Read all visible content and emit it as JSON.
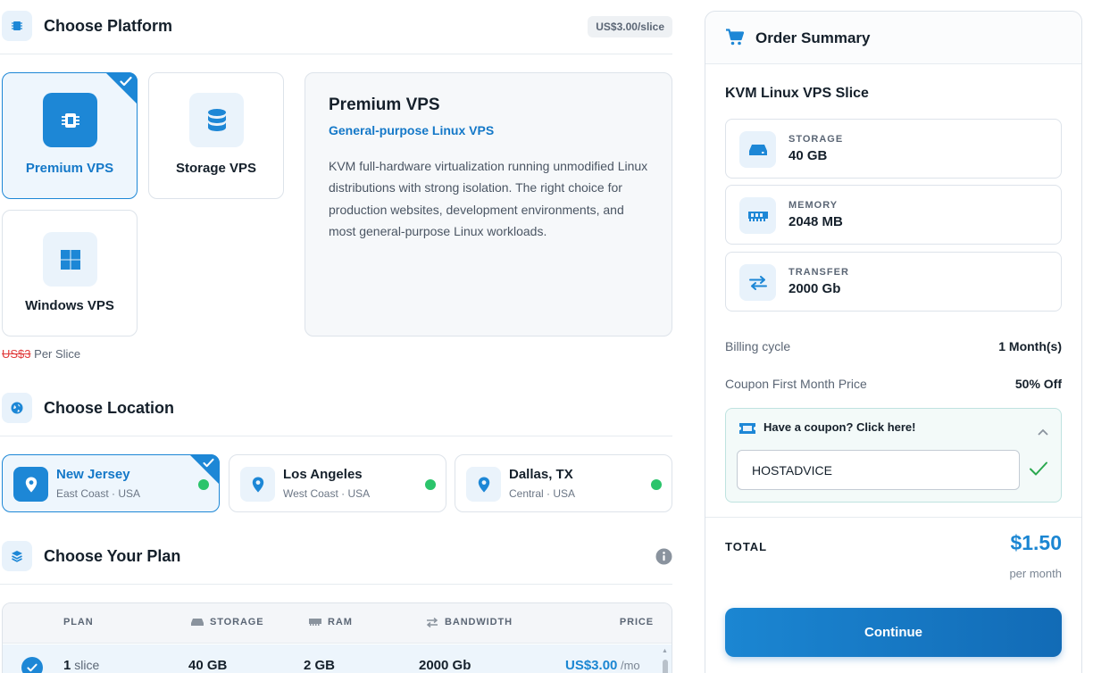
{
  "platform": {
    "title": "Choose Platform",
    "price_badge": "US$3.00/slice",
    "options": [
      {
        "label": "Premium VPS",
        "icon": "cpu-chip-icon",
        "selected": true
      },
      {
        "label": "Storage VPS",
        "icon": "database-icon",
        "selected": false
      },
      {
        "label": "Windows VPS",
        "icon": "windows-icon",
        "selected": false
      }
    ],
    "detail": {
      "title": "Premium VPS",
      "subtitle": "General-purpose Linux VPS",
      "body": "KVM full-hardware virtualization running unmodified Linux distributions with strong isolation. The right choice for production websites, development environments, and most general-purpose Linux workloads."
    },
    "old_price": "US$3",
    "per_slice": " Per Slice"
  },
  "location": {
    "title": "Choose Location",
    "options": [
      {
        "name": "New Jersey",
        "region": "East Coast · USA",
        "selected": true,
        "status": "online"
      },
      {
        "name": "Los Angeles",
        "region": "West Coast · USA",
        "selected": false,
        "status": "online"
      },
      {
        "name": "Dallas, TX",
        "region": "Central · USA",
        "selected": false,
        "status": "online"
      }
    ]
  },
  "plan": {
    "title": "Choose Your Plan",
    "columns": {
      "plan": "PLAN",
      "storage": "STORAGE",
      "ram": "RAM",
      "bandwidth": "BANDWIDTH",
      "price": "PRICE"
    },
    "rows": [
      {
        "slices": "1",
        "unit": " slice",
        "storage": "40 GB",
        "ram": "2 GB",
        "bandwidth": "2000 Gb",
        "price": "US$3.00",
        "period": " /mo",
        "selected": true
      }
    ]
  },
  "summary": {
    "title": "Order Summary",
    "product": "KVM Linux VPS Slice",
    "specs": [
      {
        "label": "STORAGE",
        "value": "40 GB",
        "icon": "hard-drive-icon"
      },
      {
        "label": "MEMORY",
        "value": "2048 MB",
        "icon": "memory-icon"
      },
      {
        "label": "TRANSFER",
        "value": "2000 Gb",
        "icon": "transfer-arrows-icon"
      }
    ],
    "billing_label": "Billing cycle",
    "billing_value": "1 Month(s)",
    "coupon_price_label": "Coupon First Month Price",
    "coupon_price_value": "50% Off",
    "coupon_prompt": "Have a coupon? Click here!",
    "coupon_code": "HOSTADVICE",
    "total_label": "TOTAL",
    "total_value": "$1.50",
    "total_period": "per month",
    "continue_label": "Continue"
  },
  "colors": {
    "accent": "#1d87d6",
    "online": "#2bc46b",
    "strike": "#e03a3a"
  }
}
